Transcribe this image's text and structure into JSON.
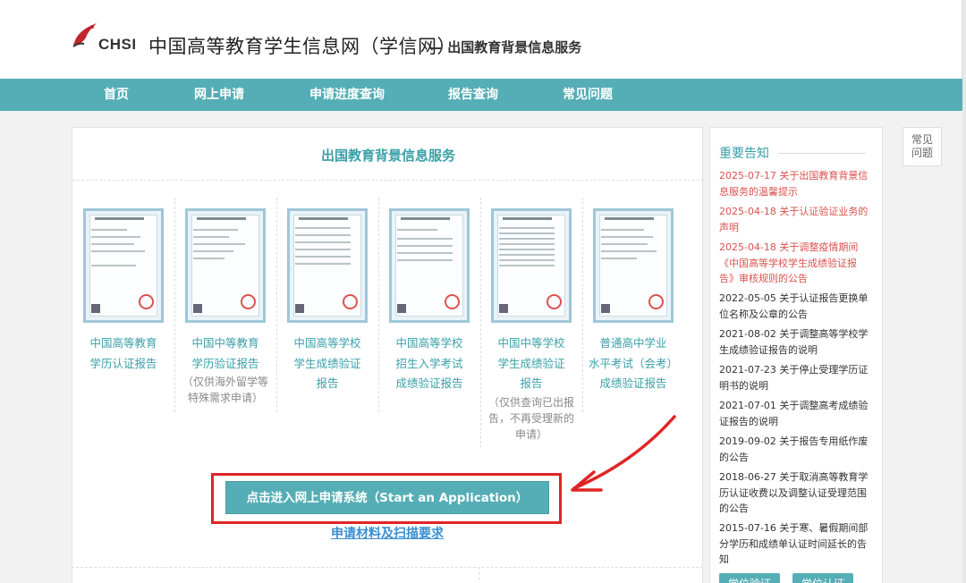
{
  "header": {
    "logo_text": "CHSI",
    "title": "中国高等教育学生信息网（学信网）",
    "subtitle": "— 出国教育背景信息服务"
  },
  "nav": {
    "items": [
      {
        "label": "首页"
      },
      {
        "label": "网上申请"
      },
      {
        "label": "申请进度查询"
      },
      {
        "label": "报告查询"
      },
      {
        "label": "常见问题"
      }
    ]
  },
  "main": {
    "title": "出国教育背景信息服务",
    "cards": [
      {
        "title_lines": [
          "中国高等教育",
          "学历认证报告"
        ],
        "note_lines": []
      },
      {
        "title_lines": [
          "中国中等教育",
          "学历验证报告"
        ],
        "note_lines": [
          "（仅供海外留学等",
          "特殊需求申请）"
        ]
      },
      {
        "title_lines": [
          "中国高等学校",
          "学生成绩验证",
          "报告"
        ],
        "note_lines": []
      },
      {
        "title_lines": [
          "中国高等学校",
          "招生入学考试",
          "成绩验证报告"
        ],
        "note_lines": []
      },
      {
        "title_lines": [
          "中国中等学校",
          "学生成绩验证",
          "报告"
        ],
        "note_lines": [
          "（仅供查询已出报",
          "告，不再受理新的",
          "申请）"
        ]
      },
      {
        "title_lines": [
          "普通高中学业",
          "水平考试（会考）",
          "成绩验证报告"
        ],
        "note_lines": []
      }
    ],
    "apply_button": "点击进入网上申请系统（Start an Application）",
    "materials_link": "申请材料及扫描要求"
  },
  "sidebar": {
    "title": "重要告知",
    "notices": [
      {
        "text": "2025-07-17 关于出国教育背景信息服务的温馨提示",
        "highlight": true
      },
      {
        "text": "2025-04-18 关于认证验证业务的声明",
        "highlight": true
      },
      {
        "text": "2025-04-18 关于调整疫情期间《中国高等学校学生成绩验证报告》审核规则的公告",
        "highlight": true
      },
      {
        "text": "2022-05-05 关于认证报告更换单位名称及公章的公告",
        "highlight": false
      },
      {
        "text": "2021-08-02 关于调整高等学校学生成绩验证报告的说明",
        "highlight": false
      },
      {
        "text": "2021-07-23 关于停止受理学历证明书的说明",
        "highlight": false
      },
      {
        "text": "2021-07-01 关于调整高考成绩验证报告的说明",
        "highlight": false
      },
      {
        "text": "2019-09-02 关于报告专用纸作废的公告",
        "highlight": false
      },
      {
        "text": "2018-06-27 关于取消高等教育学历认证收费以及调整认证受理范围的公告",
        "highlight": false
      },
      {
        "text": "2015-07-16 关于寒、暑假期间部分学历和成绩单认证时间延长的告知",
        "highlight": false
      }
    ],
    "buttons": [
      {
        "label": "学位验证"
      },
      {
        "label": "学位认证"
      }
    ]
  },
  "faq_float": {
    "line1": "常见",
    "line2": "问题"
  },
  "colors": {
    "accent": "#55aeb5",
    "link_teal": "#3aa0a8",
    "notice_red": "#d9534f",
    "highlight_box": "#e02424"
  }
}
